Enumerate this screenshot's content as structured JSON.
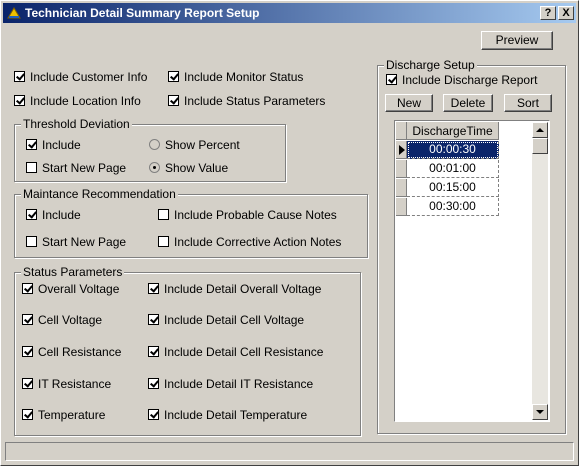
{
  "window": {
    "title": "Technician Detail Summary Report Setup",
    "help_label": "?",
    "close_label": "X"
  },
  "toolbar": {
    "preview_label": "Preview"
  },
  "general": {
    "include_customer_info": {
      "label": "Include Customer Info",
      "checked": true
    },
    "include_monitor_status": {
      "label": "Include Monitor Status",
      "checked": true
    },
    "include_location_info": {
      "label": "Include Location Info",
      "checked": true
    },
    "include_status_parameters": {
      "label": "Include Status Parameters",
      "checked": true
    }
  },
  "threshold": {
    "title": "Threshold Deviation",
    "include": {
      "label": "Include",
      "checked": true
    },
    "start_new_page": {
      "label": "Start New Page",
      "checked": false
    },
    "show_percent": {
      "label": "Show Percent",
      "selected": false
    },
    "show_value": {
      "label": "Show Value",
      "selected": true
    }
  },
  "maintenance": {
    "title": "Maintance Recommendation",
    "include": {
      "label": "Include",
      "checked": true
    },
    "start_new_page": {
      "label": "Start New Page",
      "checked": false
    },
    "probable_cause": {
      "label": "Include Probable Cause Notes",
      "checked": false
    },
    "corrective_action": {
      "label": "Include Corrective Action Notes",
      "checked": false
    }
  },
  "status_params": {
    "title": "Status Parameters",
    "items": [
      {
        "label": "Overall Voltage",
        "checked": true
      },
      {
        "label": "Include Detail Overall Voltage",
        "checked": true
      },
      {
        "label": "Cell Voltage",
        "checked": true
      },
      {
        "label": "Include Detail Cell Voltage",
        "checked": true
      },
      {
        "label": "Cell Resistance",
        "checked": true
      },
      {
        "label": "Include Detail Cell Resistance",
        "checked": true
      },
      {
        "label": "IT Resistance",
        "checked": true
      },
      {
        "label": "Include Detail IT Resistance",
        "checked": true
      },
      {
        "label": "Temperature",
        "checked": true
      },
      {
        "label": "Include Detail Temperature",
        "checked": true
      }
    ]
  },
  "discharge": {
    "title": "Discharge Setup",
    "include_report": {
      "label": "Include  Discharge Report",
      "checked": true
    },
    "new_label": "New",
    "delete_label": "Delete",
    "sort_label": "Sort",
    "column_header": "DischargeTime",
    "rows": [
      "00:00:30",
      "00:01:00",
      "00:15:00",
      "00:30:00"
    ],
    "selected_row": 0
  }
}
